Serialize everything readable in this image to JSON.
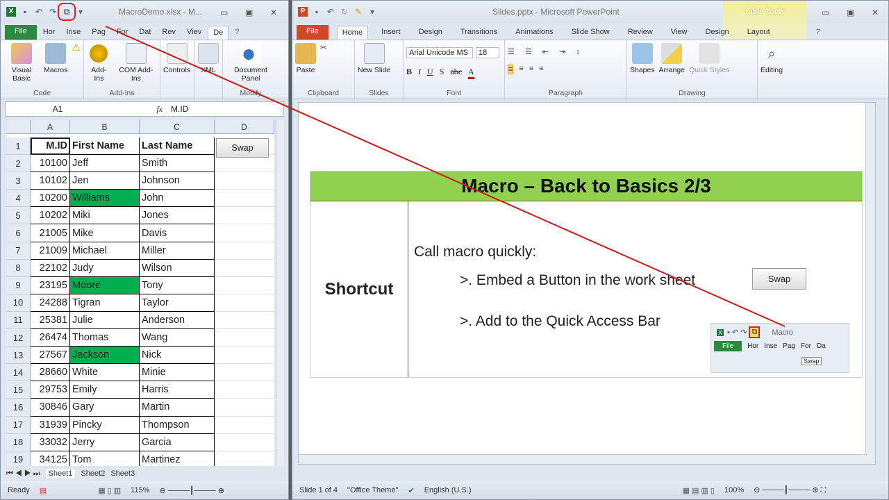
{
  "excel": {
    "title": "MacroDemo.xlsx - M...",
    "file_tab": "File",
    "tabs": [
      "Hor",
      "Inse",
      "Pag",
      "For",
      "Dat",
      "Rev",
      "Viev",
      "De"
    ],
    "groups": {
      "code": "Code",
      "addins": "Add-Ins",
      "modify": "Modify"
    },
    "buttons": {
      "visual_basic": "Visual Basic",
      "macros": "Macros",
      "addins": "Add-Ins",
      "com_addins": "COM Add-Ins",
      "controls": "Controls",
      "xml": "XML",
      "document_panel": "Document Panel"
    },
    "name_box": "A1",
    "fx": "fx",
    "formula": "M.ID",
    "columns": [
      "A",
      "B",
      "C",
      "D"
    ],
    "headers": [
      "M.ID",
      "First Name",
      "Last Name"
    ],
    "rows": [
      [
        "10100",
        "Jeff",
        "Smith",
        false
      ],
      [
        "10102",
        "Jen",
        "Johnson",
        false
      ],
      [
        "10200",
        "Williams",
        "John",
        true
      ],
      [
        "10202",
        "Miki",
        "Jones",
        false
      ],
      [
        "21005",
        "Mike",
        "Davis",
        false
      ],
      [
        "21009",
        "Michael",
        "Miller",
        false
      ],
      [
        "22102",
        "Judy",
        "Wilson",
        false
      ],
      [
        "23195",
        "Moore",
        "Tony",
        true
      ],
      [
        "24288",
        "Tigran",
        "Taylor",
        false
      ],
      [
        "25381",
        "Julie",
        "Anderson",
        false
      ],
      [
        "26474",
        "Thomas",
        "Wang",
        false
      ],
      [
        "27567",
        "Jackson",
        "Nick",
        true
      ],
      [
        "28660",
        "White",
        "Minie",
        false
      ],
      [
        "29753",
        "Emily",
        "Harris",
        false
      ],
      [
        "30846",
        "Gary",
        "Martin",
        false
      ],
      [
        "31939",
        "Pincky",
        "Thompson",
        false
      ],
      [
        "33032",
        "Jerry",
        "Garcia",
        false
      ],
      [
        "34125",
        "Tom",
        "Martinez",
        false
      ]
    ],
    "swap_button": "Swap",
    "sheets": [
      "Sheet1",
      "Sheet2",
      "Sheet3"
    ],
    "status": "Ready",
    "zoom": "115%"
  },
  "ppt": {
    "title": "Slides.pptx - Microsoft PowerPoint",
    "context_tab": "Table Tools",
    "file_tab": "File",
    "tabs": [
      "Home",
      "Insert",
      "Design",
      "Transitions",
      "Animations",
      "Slide Show",
      "Review",
      "View",
      "Design",
      "Layout"
    ],
    "groups": [
      "Clipboard",
      "Slides",
      "Font",
      "Paragraph",
      "Drawing"
    ],
    "buttons": {
      "paste": "Paste",
      "new_slide": "New Slide",
      "shapes": "Shapes",
      "arrange": "Arrange",
      "quick_styles": "Quick Styles",
      "editing": "Editing"
    },
    "font": "Arial Unicode MS",
    "font_size": "18",
    "slide": {
      "title": "Macro – Back to Basics 2/3",
      "left_cell": "Shortcut",
      "intro": "Call macro quickly:",
      "bullet1": ">. Embed a Button in the work sheet",
      "bullet2": ">. Add to the Quick Access Bar",
      "swap_button": "Swap",
      "inset": {
        "title": "Macro",
        "file": "File",
        "tabs": [
          "Hor",
          "Inse",
          "Pag",
          "For",
          "Da"
        ],
        "tooltip": "Swap"
      }
    },
    "status": {
      "slide": "Slide 1 of 4",
      "theme": "\"Office Theme\"",
      "language": "English (U.S.)",
      "zoom": "100%"
    }
  }
}
